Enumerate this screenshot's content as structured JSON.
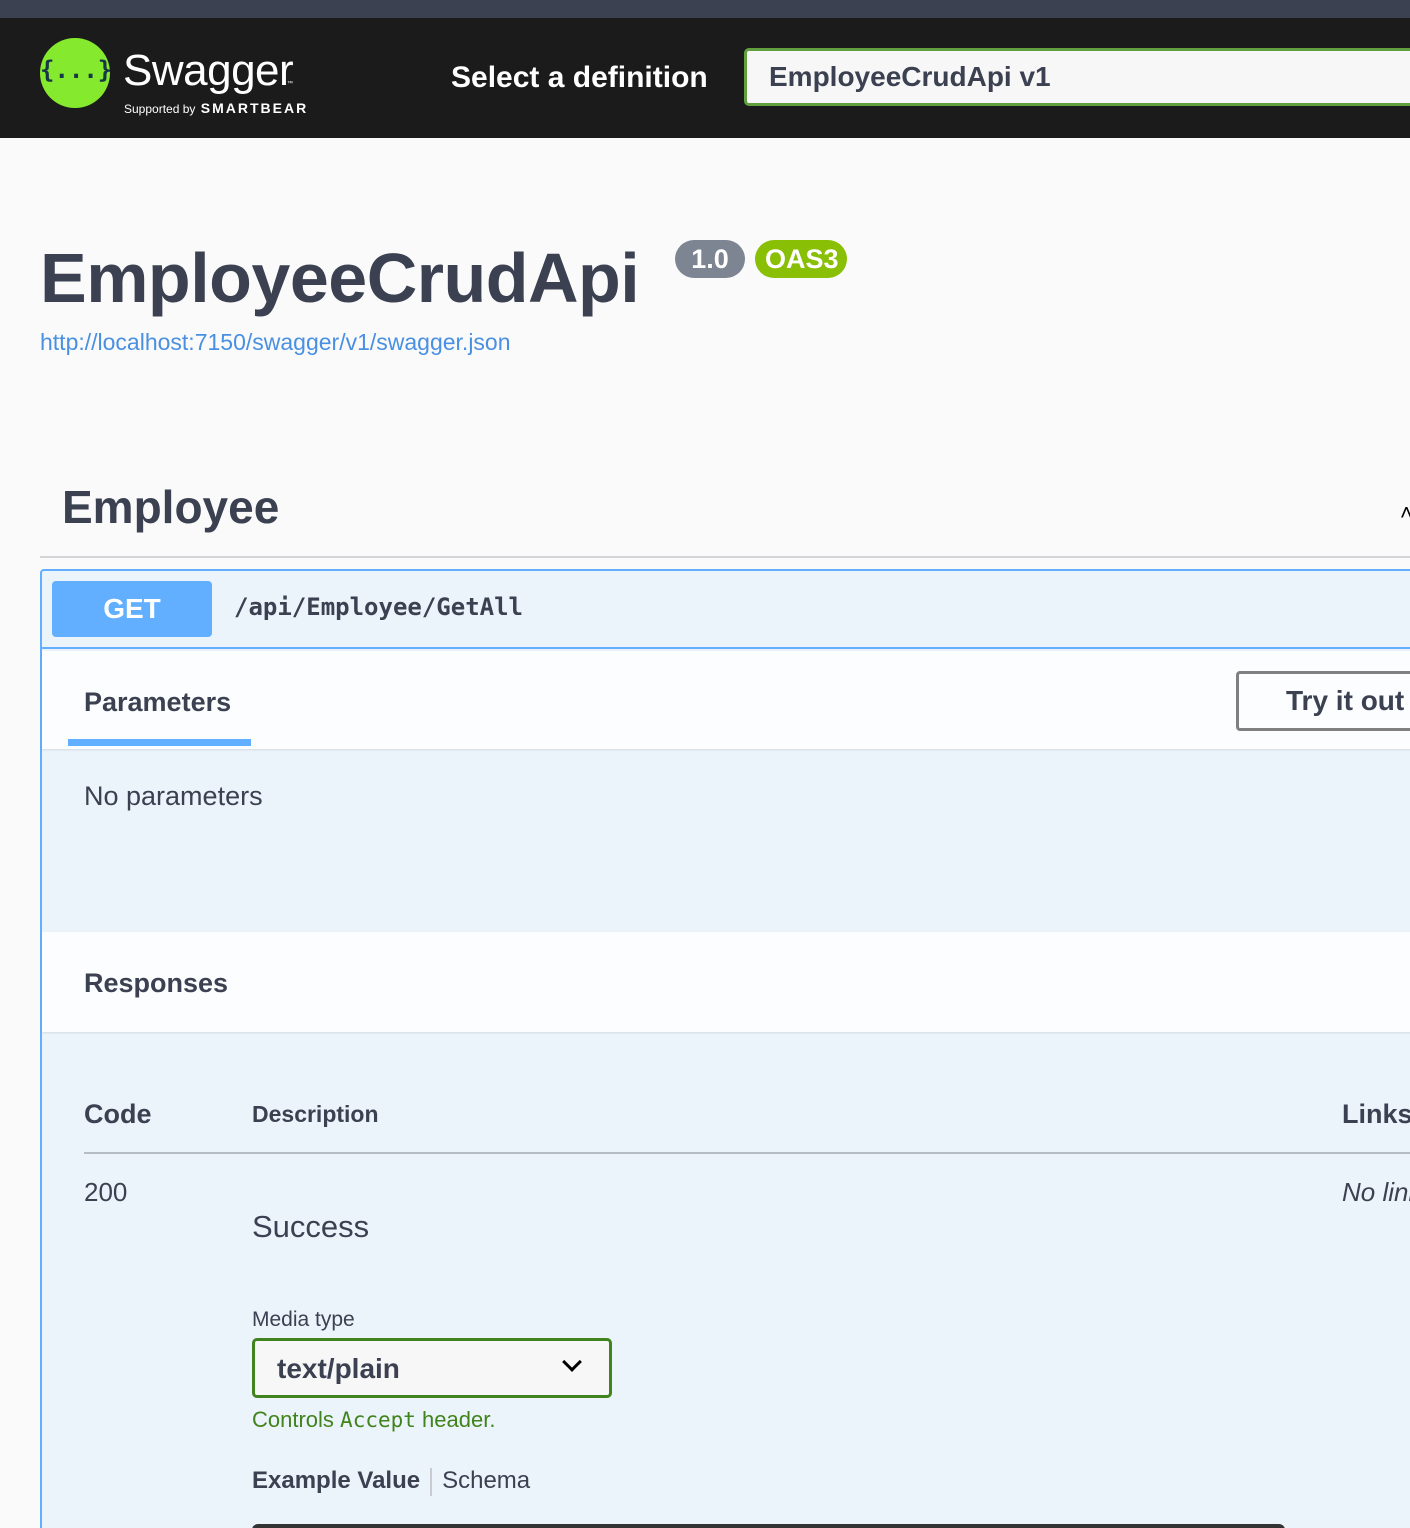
{
  "header": {
    "logo_glyph": "{...}",
    "logo_word": "Swagger",
    "logo_tm": "™",
    "logo_supported": "Supported by",
    "logo_brand": "SMARTBEAR",
    "definition_label": "Select a definition",
    "definition_value": "EmployeeCrudApi v1"
  },
  "info": {
    "title": "EmployeeCrudApi",
    "version": "1.0",
    "oas": "OAS3",
    "spec_url": "http://localhost:7150/swagger/v1/swagger.json"
  },
  "tag": {
    "name": "Employee",
    "collapse_icon": "chevron-up-icon"
  },
  "operation": {
    "method": "GET",
    "path": "/api/Employee/GetAll",
    "parameters_title": "Parameters",
    "try_it_out": "Try it out",
    "no_parameters": "No parameters",
    "responses_title": "Responses",
    "columns": {
      "code": "Code",
      "description": "Description",
      "links": "Links"
    },
    "responses": [
      {
        "code": "200",
        "description": "Success",
        "links": "No links",
        "media_type_label": "Media type",
        "media_type": "text/plain",
        "controls_prefix": "Controls",
        "controls_code": "Accept",
        "controls_suffix": "header.",
        "example_tab": "Example Value",
        "schema_tab": "Schema"
      }
    ]
  },
  "colors": {
    "topbar": "#1b1b1b",
    "accent_green": "#85ea2d",
    "get_blue": "#61affe",
    "oas_green": "#89bf04",
    "version_gray": "#7d8492",
    "link_blue": "#4990e2",
    "controls_green": "#41831c"
  }
}
